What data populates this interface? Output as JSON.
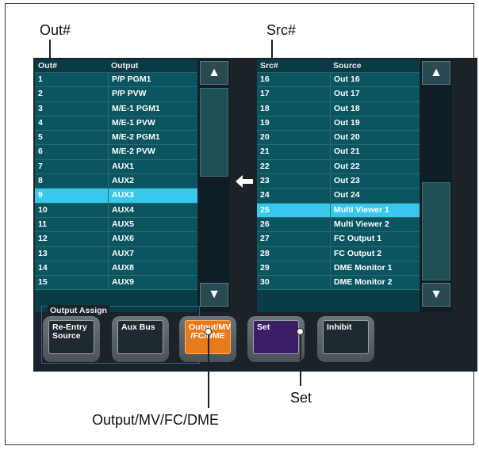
{
  "callouts": {
    "out_num": "Out#",
    "src_num": "Src#",
    "set": "Set",
    "output_mv": "Output/MV/FC/DME"
  },
  "output_table": {
    "headers": [
      "Out#",
      "Output"
    ],
    "selected_index": 8,
    "rows": [
      [
        "1",
        "P/P PGM1"
      ],
      [
        "2",
        "P/P PVW"
      ],
      [
        "3",
        "M/E-1 PGM1"
      ],
      [
        "4",
        "M/E-1 PVW"
      ],
      [
        "5",
        "M/E-2 PGM1"
      ],
      [
        "6",
        "M/E-2 PVW"
      ],
      [
        "7",
        "AUX1"
      ],
      [
        "8",
        "AUX2"
      ],
      [
        "9",
        "AUX3"
      ],
      [
        "10",
        "AUX4"
      ],
      [
        "11",
        "AUX5"
      ],
      [
        "12",
        "AUX6"
      ],
      [
        "13",
        "AUX7"
      ],
      [
        "14",
        "AUX8"
      ],
      [
        "15",
        "AUX9"
      ]
    ]
  },
  "source_table": {
    "headers": [
      "Src#",
      "Source"
    ],
    "selected_index": 9,
    "rows": [
      [
        "16",
        "Out 16"
      ],
      [
        "17",
        "Out 17"
      ],
      [
        "18",
        "Out 18"
      ],
      [
        "19",
        "Out 19"
      ],
      [
        "20",
        "Out 20"
      ],
      [
        "21",
        "Out 21"
      ],
      [
        "22",
        "Out 22"
      ],
      [
        "23",
        "Out 23"
      ],
      [
        "24",
        "Out 24"
      ],
      [
        "25",
        "Multi Viewer 1"
      ],
      [
        "26",
        "Multi Viewer 2"
      ],
      [
        "27",
        "FC Output 1"
      ],
      [
        "28",
        "FC Output 2"
      ],
      [
        "29",
        "DME Monitor 1"
      ],
      [
        "30",
        "DME Monitor 2"
      ]
    ]
  },
  "scroll": {
    "up_icon": "triangle-up-icon",
    "down_icon": "triangle-down-icon"
  },
  "output_assign": {
    "label": "Output Assign",
    "buttons": [
      "Re-Entry\nSource",
      "Aux Bus",
      "Output/MV\n/FC/DME"
    ]
  },
  "actions": {
    "set": "Set",
    "inhibit": "Inhibit"
  },
  "colors": {
    "row_bg": "#0a5560",
    "selected_row": "#38c8ec",
    "active_button": "#e87a1e",
    "set_button": "#3a1f66"
  }
}
